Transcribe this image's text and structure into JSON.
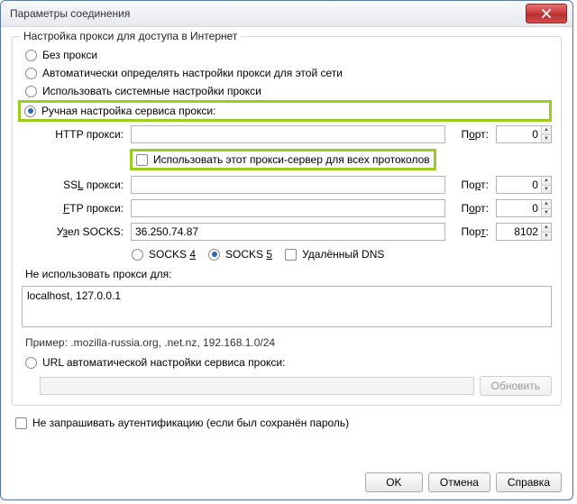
{
  "window": {
    "title": "Параметры соединения"
  },
  "group": {
    "legend": "Настройка прокси для доступа в Интернет"
  },
  "radios": {
    "none": "Без прокси",
    "auto": "Автоматически определять настройки прокси для этой сети",
    "system": "Использовать системные настройки прокси",
    "manual": "Ручная настройка сервиса прокси:",
    "autourl": "URL автоматической настройки сервиса прокси:"
  },
  "labels": {
    "http": "HTTP прокси:",
    "ssl": "SSL прокси:",
    "ftp": "FTP прокси:",
    "socks": "Узел SOCKS:",
    "port": "Порт:",
    "port_u": "Порт:",
    "use_all": "Использовать этот прокси-сервер для всех протоколов",
    "socks4": "SOCKS 4",
    "socks5": "SOCKS 5",
    "remote_dns": "Удалённый DNS",
    "no_proxy_for": "Не использовать прокси для:",
    "example": "Пример: .mozilla-russia.org, .net.nz, 192.168.1.0/24",
    "no_auth": "Не запрашивать аутентификацию (если был сохранён пароль)"
  },
  "values": {
    "http": "",
    "ssl": "",
    "ftp": "",
    "socks_host": "36.250.74.87",
    "http_port": "0",
    "ssl_port": "0",
    "ftp_port": "0",
    "socks_port": "8102",
    "no_proxy": "localhost, 127.0.0.1"
  },
  "buttons": {
    "refresh": "Обновить",
    "ok": "OK",
    "cancel": "Отмена",
    "help": "Справка"
  }
}
